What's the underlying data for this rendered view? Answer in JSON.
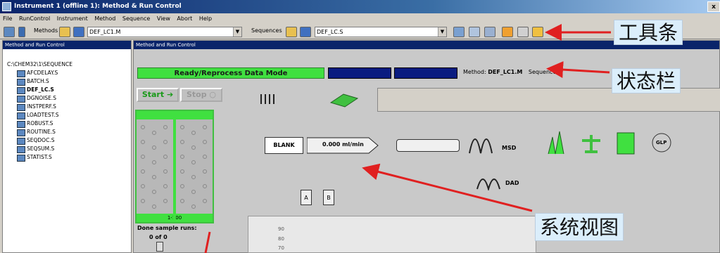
{
  "window": {
    "title": "Instrument 1 (offline 1): Method & Run Control",
    "close_glyph": "x"
  },
  "menu": [
    "File",
    "RunControl",
    "Instrument",
    "Method",
    "Sequence",
    "View",
    "Abort",
    "Help"
  ],
  "toolbar": {
    "methods_label": "Methods",
    "method_value": "DEF_LC1.M",
    "sequences_label": "Sequences",
    "sequence_value": "DEF_LC.S"
  },
  "left_pane": {
    "title": "Method and Run Control",
    "root": "C:\\CHEM32\\1\\SEQUENCE",
    "items": [
      "AFCDELAY.S",
      "BATCH.S",
      "DEF_LC.S",
      "DGNOISE.S",
      "INSTPERF.S",
      "LOADTEST.S",
      "ROBUST.S",
      "ROUTINE.S",
      "SEQDOC.S",
      "SEQSUM.S",
      "STATIST.S"
    ],
    "selected": "DEF_LC.S"
  },
  "main_pane": {
    "title": "Method and Run Control",
    "status_text": "Ready/Reprocess Data Mode",
    "method_label": "Method:",
    "method_value": "DEF_LC1.M",
    "sequence_label": "Sequence:",
    "start_label": "Start",
    "stop_label": "Stop",
    "flow_value": "0.000 ml/min",
    "blank_label": "BLANK",
    "msd_label": "MSD",
    "dad_label": "DAD",
    "glp_label": "GLP",
    "bottle_a": "A",
    "bottle_b": "B",
    "tray_number": "1-100",
    "done_label": "Done sample runs:",
    "done_value": "0 of 0",
    "y_ticks": [
      "90",
      "80",
      "70"
    ]
  },
  "annotations": {
    "toolbar": "工具条",
    "statusbar": "状态栏",
    "sysview": "系统视图"
  },
  "colors": {
    "status_green": "#40e040",
    "title_navy": "#0a246a",
    "arrow_red": "#e02020"
  }
}
